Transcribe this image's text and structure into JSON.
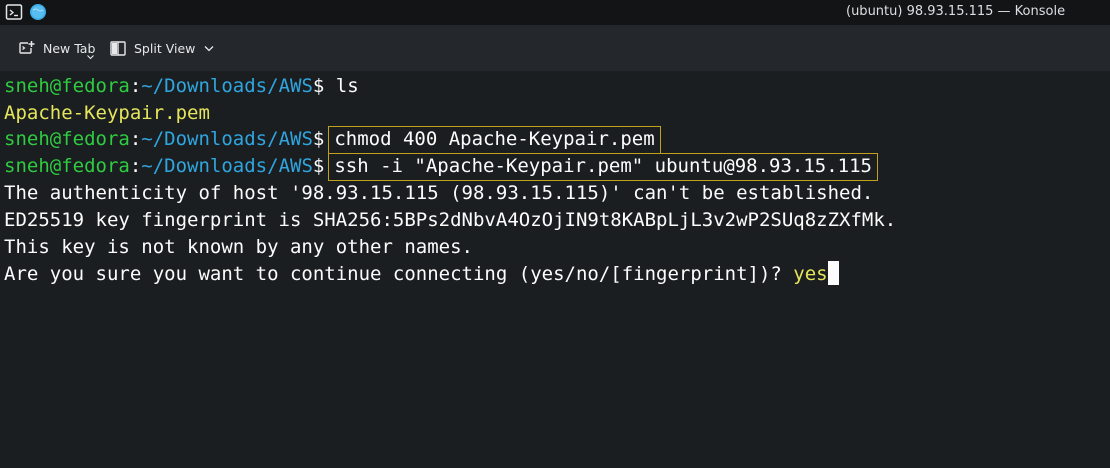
{
  "window": {
    "title": "(ubuntu) 98.93.15.115 — Konsole",
    "icons": [
      "terminal-app-icon",
      "globe-icon"
    ]
  },
  "toolbar": {
    "new_tab_label": "New Tab",
    "split_view_label": "Split View",
    "icons": [
      "new-tab-icon",
      "split-view-icon",
      "chevron-down-icon"
    ]
  },
  "terminal": {
    "prompt": {
      "user_host": "sneh@fedora",
      "sep": ":",
      "path": "~/Downloads/AWS",
      "sign": "$"
    },
    "lines": [
      {
        "type": "command",
        "text": "ls"
      },
      {
        "type": "output",
        "text": "Apache-Keypair.pem"
      },
      {
        "type": "command",
        "text": "chmod 400 Apache-Keypair.pem",
        "highlighted": true
      },
      {
        "type": "command",
        "text": "ssh -i \"Apache-Keypair.pem\" ubuntu@98.93.15.115",
        "highlighted": true
      },
      {
        "type": "output",
        "text": "The authenticity of host '98.93.15.115 (98.93.15.115)' can't be established."
      },
      {
        "type": "output",
        "text": "ED25519 key fingerprint is SHA256:5BPs2dNbvA4OzOjIN9t8KABpLjL3v2wP2SUq8zZXfMk."
      },
      {
        "type": "output",
        "text": "This key is not known by any other names."
      },
      {
        "type": "output",
        "text": "Are you sure you want to continue connecting (yes/no/[fingerprint])? ",
        "input": "yes"
      }
    ]
  },
  "colors": {
    "prompt_user": "#2fcf3f",
    "prompt_path": "#31b1e3",
    "file_output": "#e5e55b",
    "highlight_border": "#c2a01c",
    "background": "#1b1e20"
  }
}
